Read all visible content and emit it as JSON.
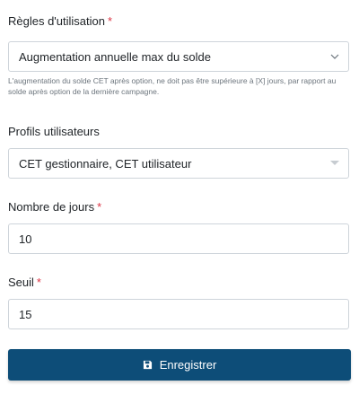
{
  "regles": {
    "label": "Règles d'utilisation",
    "required_mark": "*",
    "selected": "Augmentation annuelle max du solde",
    "help": "L'augmentation du solde CET après option, ne doit pas être supérieure à [X] jours, par rapport au solde après option de la dernière campagne."
  },
  "profils": {
    "label": "Profils utilisateurs",
    "selected": "CET gestionnaire, CET utilisateur"
  },
  "nombre_jours": {
    "label": "Nombre de jours",
    "required_mark": "*",
    "value": "10"
  },
  "seuil": {
    "label": "Seuil",
    "required_mark": "*",
    "value": "15"
  },
  "save_button": {
    "label": "Enregistrer",
    "icon": "floppy-disk-icon"
  },
  "colors": {
    "primary": "#0d4d78",
    "required": "#dc3545",
    "border": "#ced4da",
    "help_text": "#6c757d"
  }
}
